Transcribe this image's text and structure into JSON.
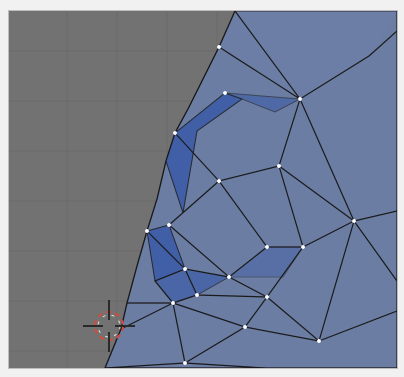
{
  "viewport": {
    "grid": "on"
  },
  "icons": {
    "cursor": "3d-cursor-crosshair-icon"
  },
  "colors": {
    "viewport_bg": "#727272",
    "grid_line": "#666666",
    "mesh_fill": "#6b7da3",
    "mesh_fill_dark": "#5f6f92",
    "selected_face_fill": "#3a5aa8",
    "edge": "#1a1a1a",
    "vertex": "#ffffff",
    "cursor_red": "#d24a3a",
    "cursor_white": "#ffffff"
  }
}
